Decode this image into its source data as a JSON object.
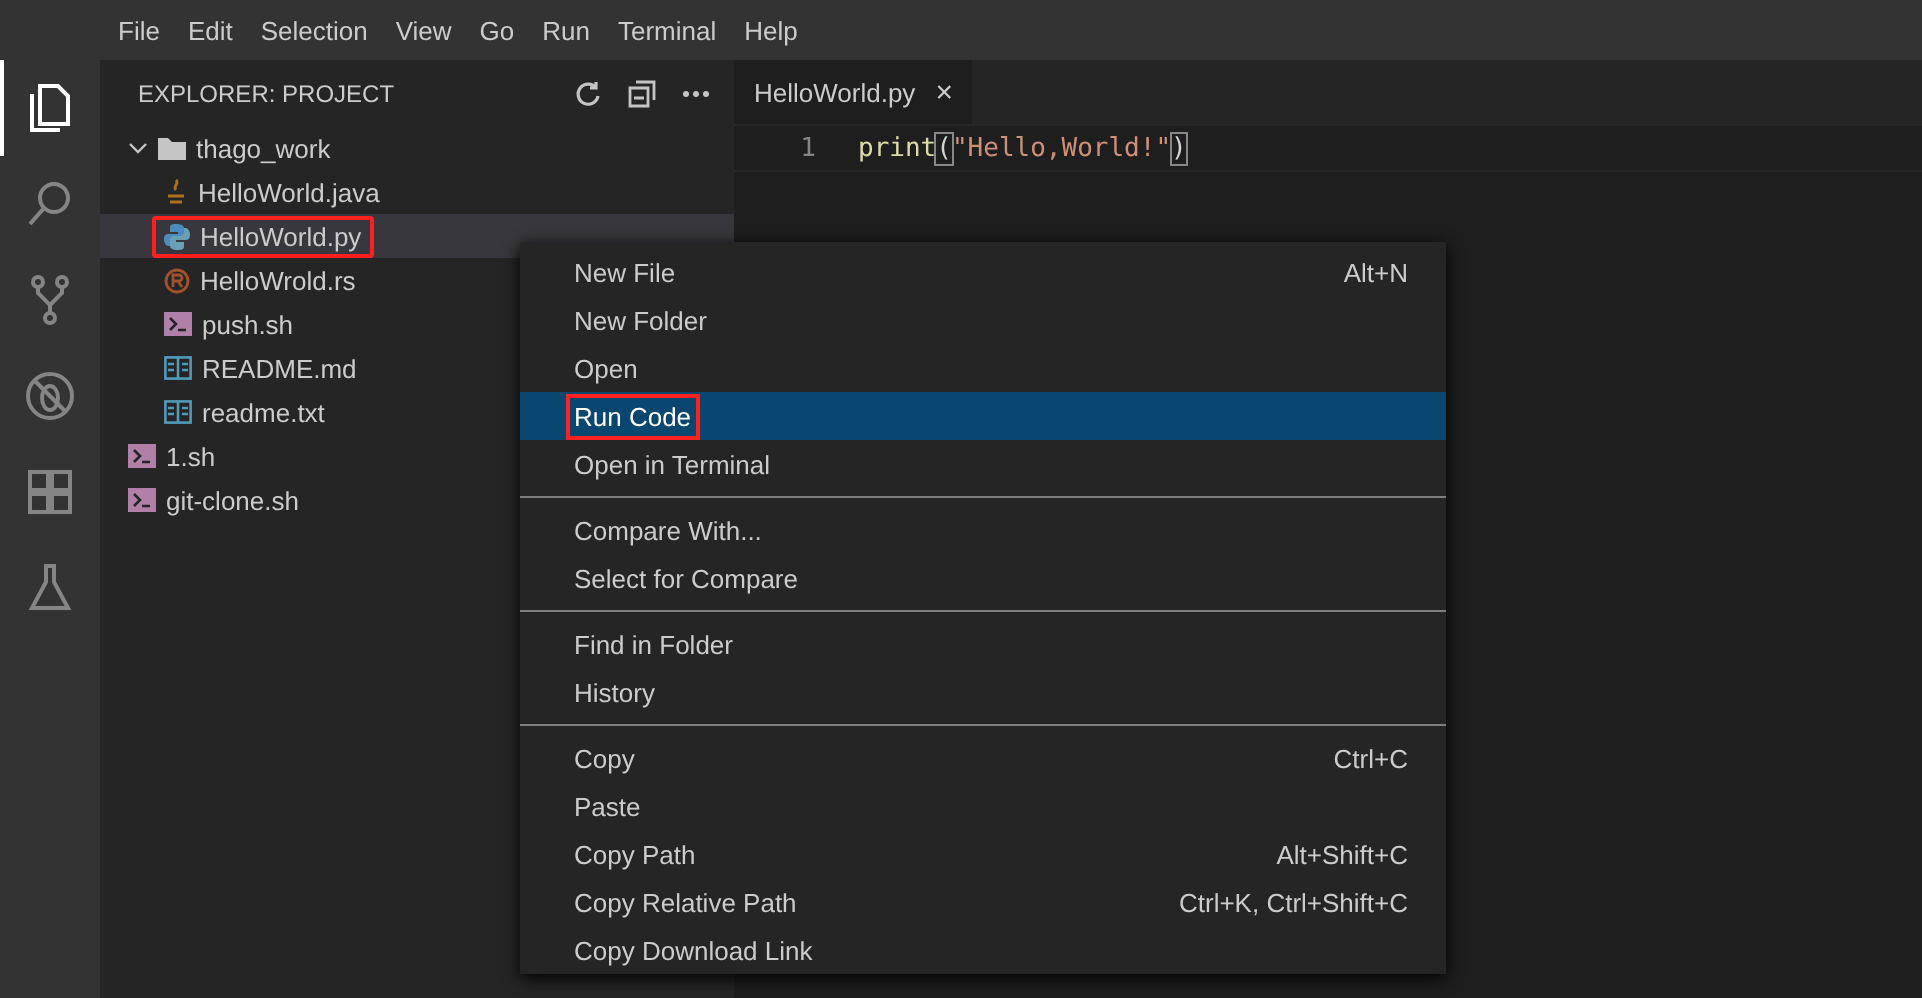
{
  "menu_bar": [
    "File",
    "Edit",
    "Selection",
    "View",
    "Go",
    "Run",
    "Terminal",
    "Help"
  ],
  "activity_bar": [
    {
      "kind": "files",
      "selected": true
    },
    {
      "kind": "search",
      "selected": false
    },
    {
      "kind": "source-control",
      "selected": false
    },
    {
      "kind": "debug",
      "selected": false
    },
    {
      "kind": "extensions",
      "selected": false
    },
    {
      "kind": "flask",
      "selected": false
    }
  ],
  "sidebar": {
    "title": "EXPLORER: PROJECT",
    "actions": [
      {
        "kind": "refresh"
      },
      {
        "kind": "collapse"
      },
      {
        "kind": "more"
      }
    ],
    "tree": [
      {
        "label": "thago_work",
        "kind": "folder",
        "expanded": true,
        "selected": false,
        "annotated": false,
        "children": [
          {
            "label": "HelloWorld.java",
            "kind": "java",
            "selected": false,
            "annotated": false
          },
          {
            "label": "HelloWorld.py",
            "kind": "python",
            "selected": true,
            "annotated": true
          },
          {
            "label": "HelloWrold.rs",
            "kind": "rust",
            "selected": false,
            "annotated": false
          },
          {
            "label": "push.sh",
            "kind": "shell",
            "selected": false,
            "annotated": false
          },
          {
            "label": "README.md",
            "kind": "markdown",
            "selected": false,
            "annotated": false
          },
          {
            "label": "readme.txt",
            "kind": "markdown",
            "selected": false,
            "annotated": false
          }
        ]
      },
      {
        "label": "1.sh",
        "kind": "shell",
        "selected": false,
        "annotated": false
      },
      {
        "label": "git-clone.sh",
        "kind": "shell",
        "selected": false,
        "annotated": false
      }
    ]
  },
  "editor": {
    "tabs": [
      {
        "label": "HelloWorld.py",
        "selected": true,
        "close": "×"
      }
    ],
    "lines": [
      {
        "number": "1",
        "func": "print",
        "open": "(",
        "string": "\"Hello,World!\"",
        "close": ")"
      }
    ]
  },
  "context_menu": {
    "groups": [
      [
        {
          "label": "New File",
          "shortcut": "Alt+N",
          "selected": false,
          "annotated": false
        },
        {
          "label": "New Folder",
          "selected": false,
          "annotated": false
        },
        {
          "label": "Open",
          "selected": false,
          "annotated": false
        },
        {
          "label": "Run Code",
          "selected": true,
          "annotated": true
        },
        {
          "label": "Open in Terminal",
          "selected": false,
          "annotated": false
        }
      ],
      [
        {
          "label": "Compare With...",
          "selected": false,
          "annotated": false
        },
        {
          "label": "Select for Compare",
          "selected": false,
          "annotated": false
        }
      ],
      [
        {
          "label": "Find in Folder",
          "selected": false,
          "annotated": false
        },
        {
          "label": "History",
          "selected": false,
          "annotated": false
        }
      ],
      [
        {
          "label": "Copy",
          "shortcut": "Ctrl+C",
          "selected": false,
          "annotated": false
        },
        {
          "label": "Paste",
          "selected": false,
          "annotated": false
        },
        {
          "label": "Copy Path",
          "shortcut": "Alt+Shift+C",
          "selected": false,
          "annotated": false
        },
        {
          "label": "Copy Relative Path",
          "shortcut": "Ctrl+K, Ctrl+Shift+C",
          "selected": false,
          "annotated": false
        },
        {
          "label": "Copy Download Link",
          "selected": false,
          "annotated": false
        }
      ]
    ]
  }
}
